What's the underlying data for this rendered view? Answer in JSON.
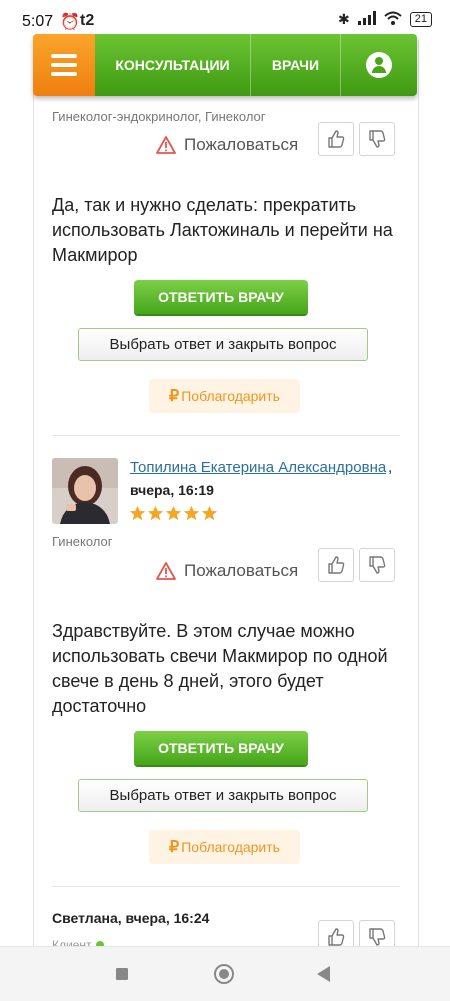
{
  "status_bar": {
    "time": "5:07",
    "carrier": "t2",
    "battery": "21"
  },
  "nav": {
    "menu_icon": "hamburger-icon",
    "consult_label": "КОНСУЛЬТАЦИИ",
    "doctors_label": "ВРАЧИ",
    "user_icon": "user-icon"
  },
  "answer1": {
    "specialty": "Гинеколог-эндокринолог, Гинеколог",
    "report_label": "Пожаловаться",
    "text": "Да, так и нужно сделать: прекратить использовать Лактожиналь и перейти на Макмирор",
    "reply_label": "ОТВЕТИТЬ ВРАЧУ",
    "close_label": "Выбрать ответ и закрыть вопрос",
    "thanks_label": "Поблагодарить",
    "currency_symbol": "₽"
  },
  "answer2": {
    "author": "Топилина Екатерина Александровна",
    "author_comma": ",",
    "time": "вчера, 16:19",
    "rating": 5,
    "specialty": "Гинеколог",
    "report_label": "Пожаловаться",
    "text": "Здравствуйте. В этом случае можно использовать свечи Макмирор по одной свече в день 8 дней, этого будет достаточно",
    "reply_label": "ОТВЕТИТЬ ВРАЧУ",
    "close_label": "Выбрать ответ и закрыть вопрос",
    "thanks_label": "Поблагодарить",
    "currency_symbol": "₽"
  },
  "comment": {
    "author_time": "Светлана, вчера, 16:24",
    "role": "Клиент"
  },
  "colors": {
    "green": "#4aa51c",
    "orange": "#f0951f",
    "link": "#2a6fa0"
  }
}
